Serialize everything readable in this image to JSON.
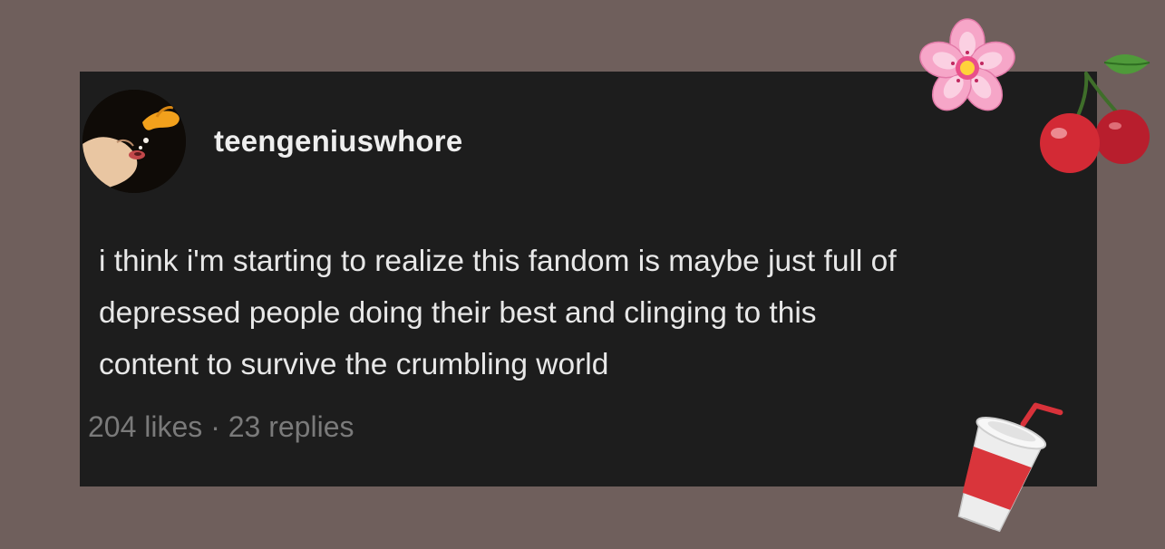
{
  "post": {
    "username": "teengeniuswhore",
    "body_lines": [
      "i think i'm starting to realize this fandom is maybe just full of",
      "depressed people doing their best and clinging to this",
      "content to survive the crumbling world"
    ],
    "likes": "204 likes",
    "separator": "·",
    "replies": "23 replies"
  },
  "stickers": [
    "cherry-blossom-icon",
    "cherries-icon",
    "drink-cup-icon"
  ],
  "colors": {
    "background": "#6f5f5c",
    "card": "#1d1d1d",
    "text": "#e8e8e8",
    "meta_text": "#7a7a7a"
  }
}
